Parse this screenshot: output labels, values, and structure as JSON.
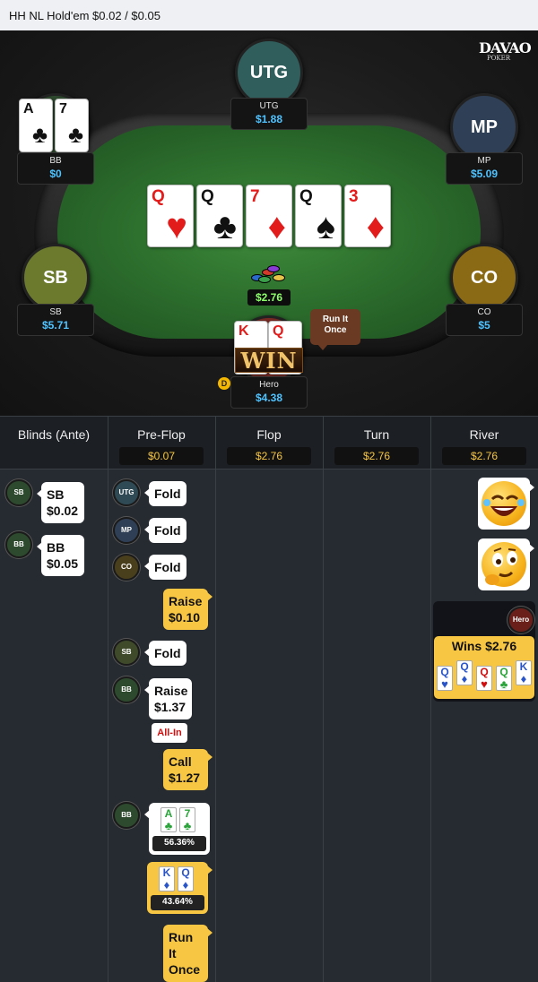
{
  "title": "HH NL Hold'em $0.02 / $0.05",
  "logo": {
    "top": "DAVAO",
    "bottom": "POKER"
  },
  "seats": [
    {
      "pos": "UTG",
      "name": "UTG",
      "stack": "$1.88",
      "color": "#2f5e5c"
    },
    {
      "pos": "MP",
      "name": "MP",
      "stack": "$5.09",
      "color": "#2f3f55"
    },
    {
      "pos": "BB",
      "name": "BB",
      "stack": "$0",
      "color": "#2e4a2e"
    },
    {
      "pos": "SB",
      "name": "SB",
      "stack": "$5.71",
      "color": "#6b7a2c"
    },
    {
      "pos": "CO",
      "name": "CO",
      "stack": "$5",
      "color": "#8a6a14"
    },
    {
      "pos": "Hero",
      "name": "Hero",
      "stack": "$4.38",
      "color": "#7a2a24"
    }
  ],
  "bb_hand": [
    {
      "rank": "A",
      "suit": "♣",
      "color": "blk"
    },
    {
      "rank": "7",
      "suit": "♣",
      "color": "blk"
    }
  ],
  "hero_hand": [
    {
      "rank": "K",
      "suit": "♦",
      "color": "red"
    },
    {
      "rank": "Q",
      "suit": "♦",
      "color": "red"
    }
  ],
  "board": [
    {
      "rank": "Q",
      "suit": "♥",
      "color": "red"
    },
    {
      "rank": "Q",
      "suit": "♣",
      "color": "blk"
    },
    {
      "rank": "7",
      "suit": "♦",
      "color": "red"
    },
    {
      "rank": "Q",
      "suit": "♠",
      "color": "blk"
    },
    {
      "rank": "3",
      "suit": "♦",
      "color": "red"
    }
  ],
  "pot": "$2.76",
  "win_text": "WIN",
  "run_it_bubble": "Run It Once",
  "dealer_label": "D",
  "columns": [
    {
      "title": "Blinds (Ante)",
      "pot": ""
    },
    {
      "title": "Pre-Flop",
      "pot": "$0.07"
    },
    {
      "title": "Flop",
      "pot": "$2.76"
    },
    {
      "title": "Turn",
      "pot": "$2.76"
    },
    {
      "title": "River",
      "pot": "$2.76"
    }
  ],
  "blinds": [
    {
      "pos": "SB",
      "text": "SB $0.02"
    },
    {
      "pos": "BB",
      "text": "BB $0.05"
    }
  ],
  "preflop": [
    {
      "pos": "UTG",
      "action": "Fold"
    },
    {
      "pos": "MP",
      "action": "Fold"
    },
    {
      "pos": "CO",
      "action": "Fold"
    },
    {
      "pos": "Hero",
      "action": "Raise $0.10"
    },
    {
      "pos": "SB",
      "action": "Fold"
    },
    {
      "pos": "BB",
      "action": "Raise $1.37"
    },
    {
      "pos": "Hero",
      "action": "Call $1.27"
    }
  ],
  "allin_label": "All-In",
  "showdown": {
    "bb_pos": "BB",
    "bb_cards": [
      {
        "rank": "A",
        "suit": "♣",
        "color": "green"
      },
      {
        "rank": "7",
        "suit": "♣",
        "color": "green"
      }
    ],
    "bb_equity": "56.36%",
    "hero_cards": [
      {
        "rank": "K",
        "suit": "♦",
        "color": "blue"
      },
      {
        "rank": "Q",
        "suit": "♦",
        "color": "blue"
      }
    ],
    "hero_equity": "43.64%"
  },
  "run_it_action": "Run It Once",
  "river": {
    "emojis": [
      "laughing-emoji",
      "thinking-emoji"
    ],
    "winner": "Hero",
    "win_label": "Wins $2.76",
    "win_cards": [
      {
        "rank": "Q",
        "suit": "♥",
        "color": "blue"
      },
      {
        "rank": "Q",
        "suit": "♦",
        "color": "blue"
      },
      {
        "rank": "Q",
        "suit": "♥",
        "color": "red"
      },
      {
        "rank": "Q",
        "suit": "♣",
        "color": "green"
      },
      {
        "rank": "K",
        "suit": "♦",
        "color": "blue"
      }
    ]
  }
}
